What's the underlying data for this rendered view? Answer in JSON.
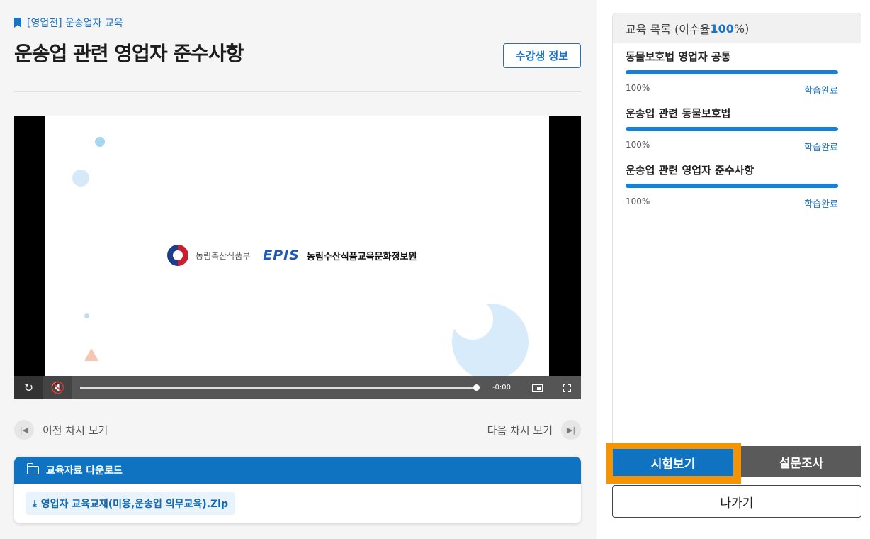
{
  "breadcrumb": "[영업전] 운송업자 교육",
  "page_title": "운송업 관련 영업자 준수사항",
  "student_info_label": "수강생 정보",
  "video": {
    "ministry_name": "농림축산식품부",
    "epis_logo": "EPIS",
    "epis_name": "농림수산식품교육문화정보원",
    "time": "-0:00",
    "progress": 1.0
  },
  "nav": {
    "prev_label": "이전 차시 보기",
    "next_label": "다음 차시 보기"
  },
  "download": {
    "header": "교육자료 다운로드",
    "file_name": "영업자 교육교재(미용,운송업 의무교육).Zip"
  },
  "toc": {
    "header_prefix": "교육 목록 (이수율 ",
    "rate": "100",
    "header_suffix": "%)",
    "items": [
      {
        "name": "동물보호법 영업자 공통",
        "percent_text": "100%",
        "status": "학습완료",
        "progress": 1.0
      },
      {
        "name": "운송업 관련 동물보호법",
        "percent_text": "100%",
        "status": "학습완료",
        "progress": 1.0
      },
      {
        "name": "운송업 관련 영업자 준수사항",
        "percent_text": "100%",
        "status": "학습완료",
        "progress": 1.0
      }
    ]
  },
  "buttons": {
    "exam": "시험보기",
    "survey": "설문조사",
    "exit": "나가기"
  },
  "colors": {
    "accent": "#1a73c7",
    "highlight": "#f59400",
    "survey_bg": "#5a5a5a"
  }
}
